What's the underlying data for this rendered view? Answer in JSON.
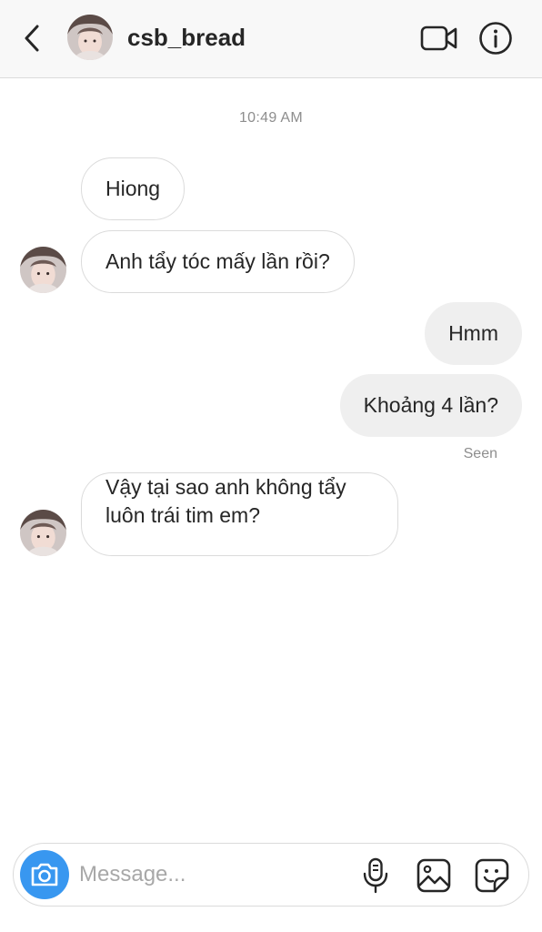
{
  "header": {
    "username": "csb_bread",
    "back_icon": "chevron-left-icon",
    "video_icon": "video-camera-icon",
    "info_icon": "info-icon"
  },
  "thread": {
    "timestamp": "10:49 AM",
    "messages": [
      {
        "from": "them",
        "text": "Hiong"
      },
      {
        "from": "them",
        "text": "Anh tẩy tóc mấy lần rồi?"
      },
      {
        "from": "me",
        "text": "Hmm"
      },
      {
        "from": "me",
        "text": "Khoảng 4 lần?"
      },
      {
        "from": "them",
        "text": "Vậy tại sao anh không tẩy luôn trái tim em?"
      }
    ],
    "seen_label": "Seen"
  },
  "composer": {
    "placeholder": "Message...",
    "value": "",
    "camera_icon": "camera-icon",
    "mic_icon": "microphone-icon",
    "gallery_icon": "image-icon",
    "sticker_icon": "sticker-icon"
  },
  "colors": {
    "accent": "#3897f0",
    "outgoing_bubble": "#efefef",
    "incoming_border": "#dbdbdb",
    "header_bg": "#f8f8f8",
    "muted_text": "#8e8e8e"
  }
}
